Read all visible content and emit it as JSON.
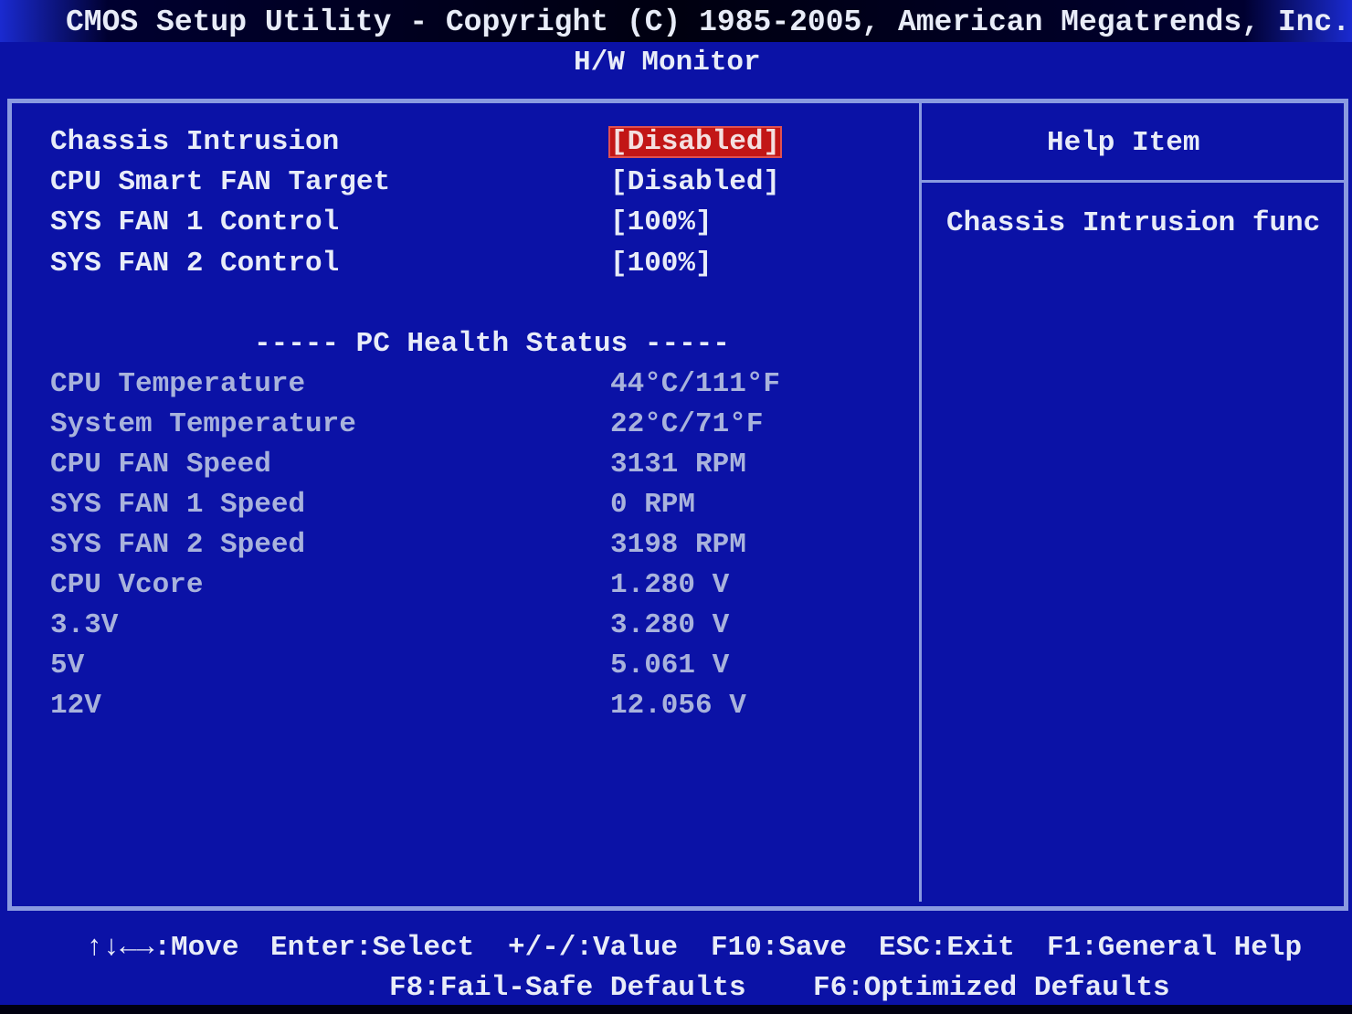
{
  "header": {
    "title": "CMOS Setup Utility - Copyright (C) 1985-2005, American Megatrends, Inc.",
    "subtitle": "H/W Monitor"
  },
  "settings": [
    {
      "label": "Chassis Intrusion",
      "value": "[Disabled]",
      "selected": true
    },
    {
      "label": "CPU Smart FAN Target",
      "value": "[Disabled]"
    },
    {
      "label": "SYS FAN 1 Control",
      "value": "[100%]"
    },
    {
      "label": "SYS FAN 2 Control",
      "value": "[100%]"
    }
  ],
  "health": {
    "heading": "----- PC Health Status -----",
    "rows": [
      {
        "label": "CPU Temperature",
        "value": "44°C/111°F"
      },
      {
        "label": "System Temperature",
        "value": "22°C/71°F"
      },
      {
        "label": "CPU FAN Speed",
        "value": "3131 RPM"
      },
      {
        "label": "SYS FAN 1 Speed",
        "value": "0 RPM"
      },
      {
        "label": "SYS FAN 2 Speed",
        "value": "3198 RPM"
      },
      {
        "label": "CPU Vcore",
        "value": "1.280 V"
      },
      {
        "label": "3.3V",
        "value": "3.280 V"
      },
      {
        "label": "5V",
        "value": "5.061 V"
      },
      {
        "label": "12V",
        "value": "12.056 V"
      }
    ]
  },
  "help": {
    "title": "Help Item",
    "text": "Chassis Intrusion func"
  },
  "keys": {
    "line1": [
      "↑↓←→:Move",
      "Enter:Select",
      "+/-/:Value",
      "F10:Save",
      "ESC:Exit",
      "F1:General Help"
    ],
    "line2": [
      "F8:Fail-Safe Defaults",
      "F6:Optimized Defaults"
    ]
  },
  "colors": {
    "background": "#0b12a6",
    "border": "#8a9ae0",
    "highlight": "#c21616"
  }
}
